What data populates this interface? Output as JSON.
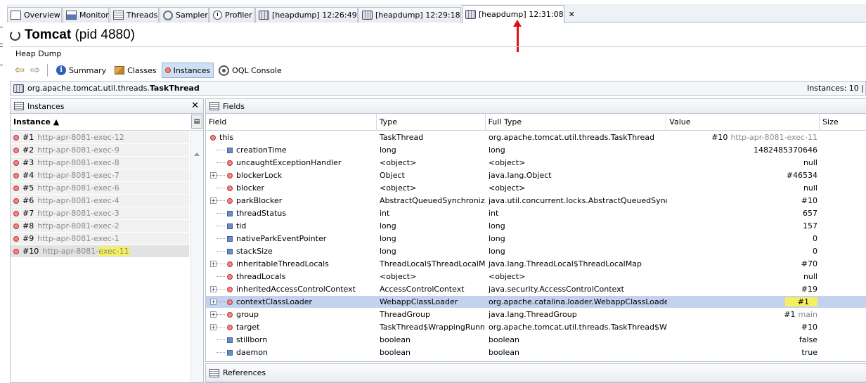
{
  "tabs": [
    {
      "label": "Overview",
      "icon": "overview-icon",
      "close": ""
    },
    {
      "label": "Monitor",
      "icon": "monitor-icon",
      "close": ""
    },
    {
      "label": "Threads",
      "icon": "threads-icon",
      "close": ""
    },
    {
      "label": "Sampler",
      "icon": "sampler-icon",
      "close": ""
    },
    {
      "label": "Profiler",
      "icon": "profiler-icon",
      "close": ""
    },
    {
      "label": "[heapdump] 12:26:49",
      "icon": "heapdump-icon",
      "close": "✕"
    },
    {
      "label": "[heapdump] 12:29:18",
      "icon": "heapdump-icon",
      "close": "✕"
    },
    {
      "label": "[heapdump] 12:31:08",
      "icon": "heapdump-icon",
      "close": "✕"
    }
  ],
  "app": {
    "name": "Tomcat",
    "pid": "(pid 4880)"
  },
  "heap_dump_label": "Heap Dump",
  "toolbar": {
    "back": "⇦",
    "forward": "⇨",
    "summary": "Summary",
    "classes": "Classes",
    "instances": "Instances",
    "oql": "OQL Console"
  },
  "classbar": {
    "package": "org.apache.tomcat.util.threads.",
    "class": "TaskThread",
    "instances": "Instances: 10 |"
  },
  "instances_panel": {
    "title": "Instances",
    "close": "✕",
    "column": "Instance ▲",
    "rows": [
      {
        "id": "#1",
        "name": "http-apr-8081-exec-12"
      },
      {
        "id": "#2",
        "name": "http-apr-8081-exec-9"
      },
      {
        "id": "#3",
        "name": "http-apr-8081-exec-8"
      },
      {
        "id": "#4",
        "name": "http-apr-8081-exec-7"
      },
      {
        "id": "#5",
        "name": "http-apr-8081-exec-6"
      },
      {
        "id": "#6",
        "name": "http-apr-8081-exec-4"
      },
      {
        "id": "#7",
        "name": "http-apr-8081-exec-3"
      },
      {
        "id": "#8",
        "name": "http-apr-8081-exec-2"
      },
      {
        "id": "#9",
        "name": "http-apr-8081-exec-1"
      },
      {
        "id": "#10",
        "name": "http-apr-8081-",
        "name_highlight": "exec-11"
      }
    ]
  },
  "fields_panel": {
    "title": "Fields",
    "columns": [
      "Field",
      "Type",
      "Full Type",
      "Value",
      "Size"
    ],
    "rows": [
      {
        "field": "this",
        "kind": "object",
        "root": true,
        "type": "TaskThread",
        "full": "org.apache.tomcat.util.threads.TaskThread",
        "value": "#10",
        "value_note": "http-apr-8081-exec-11"
      },
      {
        "field": "creationTime",
        "kind": "primitive",
        "type": "long",
        "full": "long",
        "value": "1482485370646"
      },
      {
        "field": "uncaughtExceptionHandler",
        "kind": "object",
        "type": "<object>",
        "full": "<object>",
        "value": "null"
      },
      {
        "field": "blockerLock",
        "kind": "object",
        "expand": true,
        "type": "Object",
        "full": "java.lang.Object",
        "value": "#46534"
      },
      {
        "field": "blocker",
        "kind": "object",
        "type": "<object>",
        "full": "<object>",
        "value": "null"
      },
      {
        "field": "parkBlocker",
        "kind": "object",
        "expand": true,
        "type": "AbstractQueuedSynchroniz...",
        "full": "java.util.concurrent.locks.AbstractQueuedSynchr...",
        "value": "#10"
      },
      {
        "field": "threadStatus",
        "kind": "primitive",
        "type": "int",
        "full": "int",
        "value": "657"
      },
      {
        "field": "tid",
        "kind": "primitive",
        "type": "long",
        "full": "long",
        "value": "157"
      },
      {
        "field": "nativeParkEventPointer",
        "kind": "primitive",
        "type": "long",
        "full": "long",
        "value": "0"
      },
      {
        "field": "stackSize",
        "kind": "primitive",
        "type": "long",
        "full": "long",
        "value": "0"
      },
      {
        "field": "inheritableThreadLocals",
        "kind": "object",
        "expand": true,
        "type": "ThreadLocal$ThreadLocalMap",
        "full": "java.lang.ThreadLocal$ThreadLocalMap",
        "value": "#70"
      },
      {
        "field": "threadLocals",
        "kind": "object",
        "type": "<object>",
        "full": "<object>",
        "value": "null"
      },
      {
        "field": "inheritedAccessControlContext",
        "kind": "object",
        "expand": true,
        "type": "AccessControlContext",
        "full": "java.security.AccessControlContext",
        "value": "#19"
      },
      {
        "field": "contextClassLoader",
        "kind": "object",
        "expand": true,
        "selected": true,
        "type": "WebappClassLoader",
        "full": "org.apache.catalina.loader.WebappClassLoader",
        "value": "#1",
        "value_highlight": true
      },
      {
        "field": "group",
        "kind": "object",
        "expand": true,
        "type": "ThreadGroup",
        "full": "java.lang.ThreadGroup",
        "value": "#1",
        "value_note": "main"
      },
      {
        "field": "target",
        "kind": "object",
        "expand": true,
        "type": "TaskThread$WrappingRunn...",
        "full": "org.apache.tomcat.util.threads.TaskThread$Wra...",
        "value": "#10"
      },
      {
        "field": "stillborn",
        "kind": "primitive",
        "type": "boolean",
        "full": "boolean",
        "value": "false"
      },
      {
        "field": "daemon",
        "kind": "primitive",
        "type": "boolean",
        "full": "boolean",
        "value": "true"
      }
    ]
  },
  "references_panel": {
    "title": "References"
  },
  "colors": {
    "selection": "#c3d3ef",
    "highlight": "#f4f060",
    "arrow": "#e01010"
  }
}
